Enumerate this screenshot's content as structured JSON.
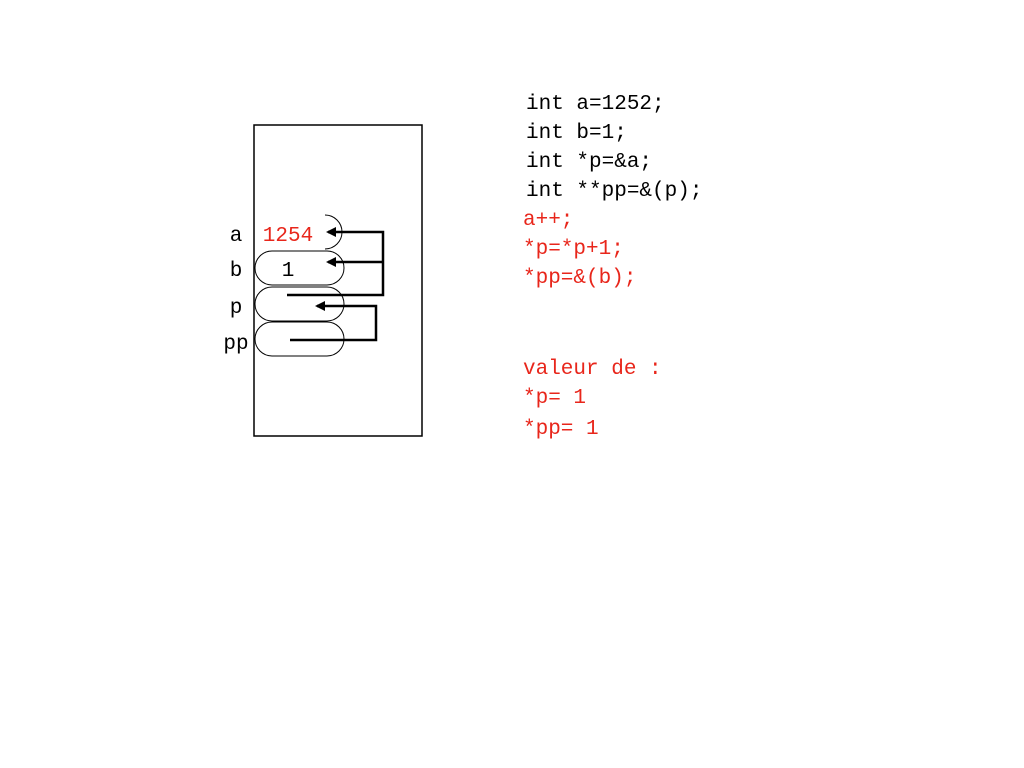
{
  "memory": {
    "cells": [
      {
        "label": "a",
        "value": "1254"
      },
      {
        "label": "b",
        "value": "1"
      },
      {
        "label": "p",
        "value": ""
      },
      {
        "label": "pp",
        "value": ""
      }
    ]
  },
  "code": {
    "declarations": [
      "int a=1252;",
      "int b=1;",
      "int *p=&a;",
      "int **pp=&(p);"
    ],
    "statements": [
      "a++;",
      "*p=*p+1;",
      "*pp=&(b);"
    ],
    "result_heading": "valeur de :",
    "results": [
      "*p= 1",
      "*pp= 1"
    ]
  },
  "colors": {
    "text": "#000000",
    "highlight": "#e8261b",
    "line": "#000000"
  }
}
